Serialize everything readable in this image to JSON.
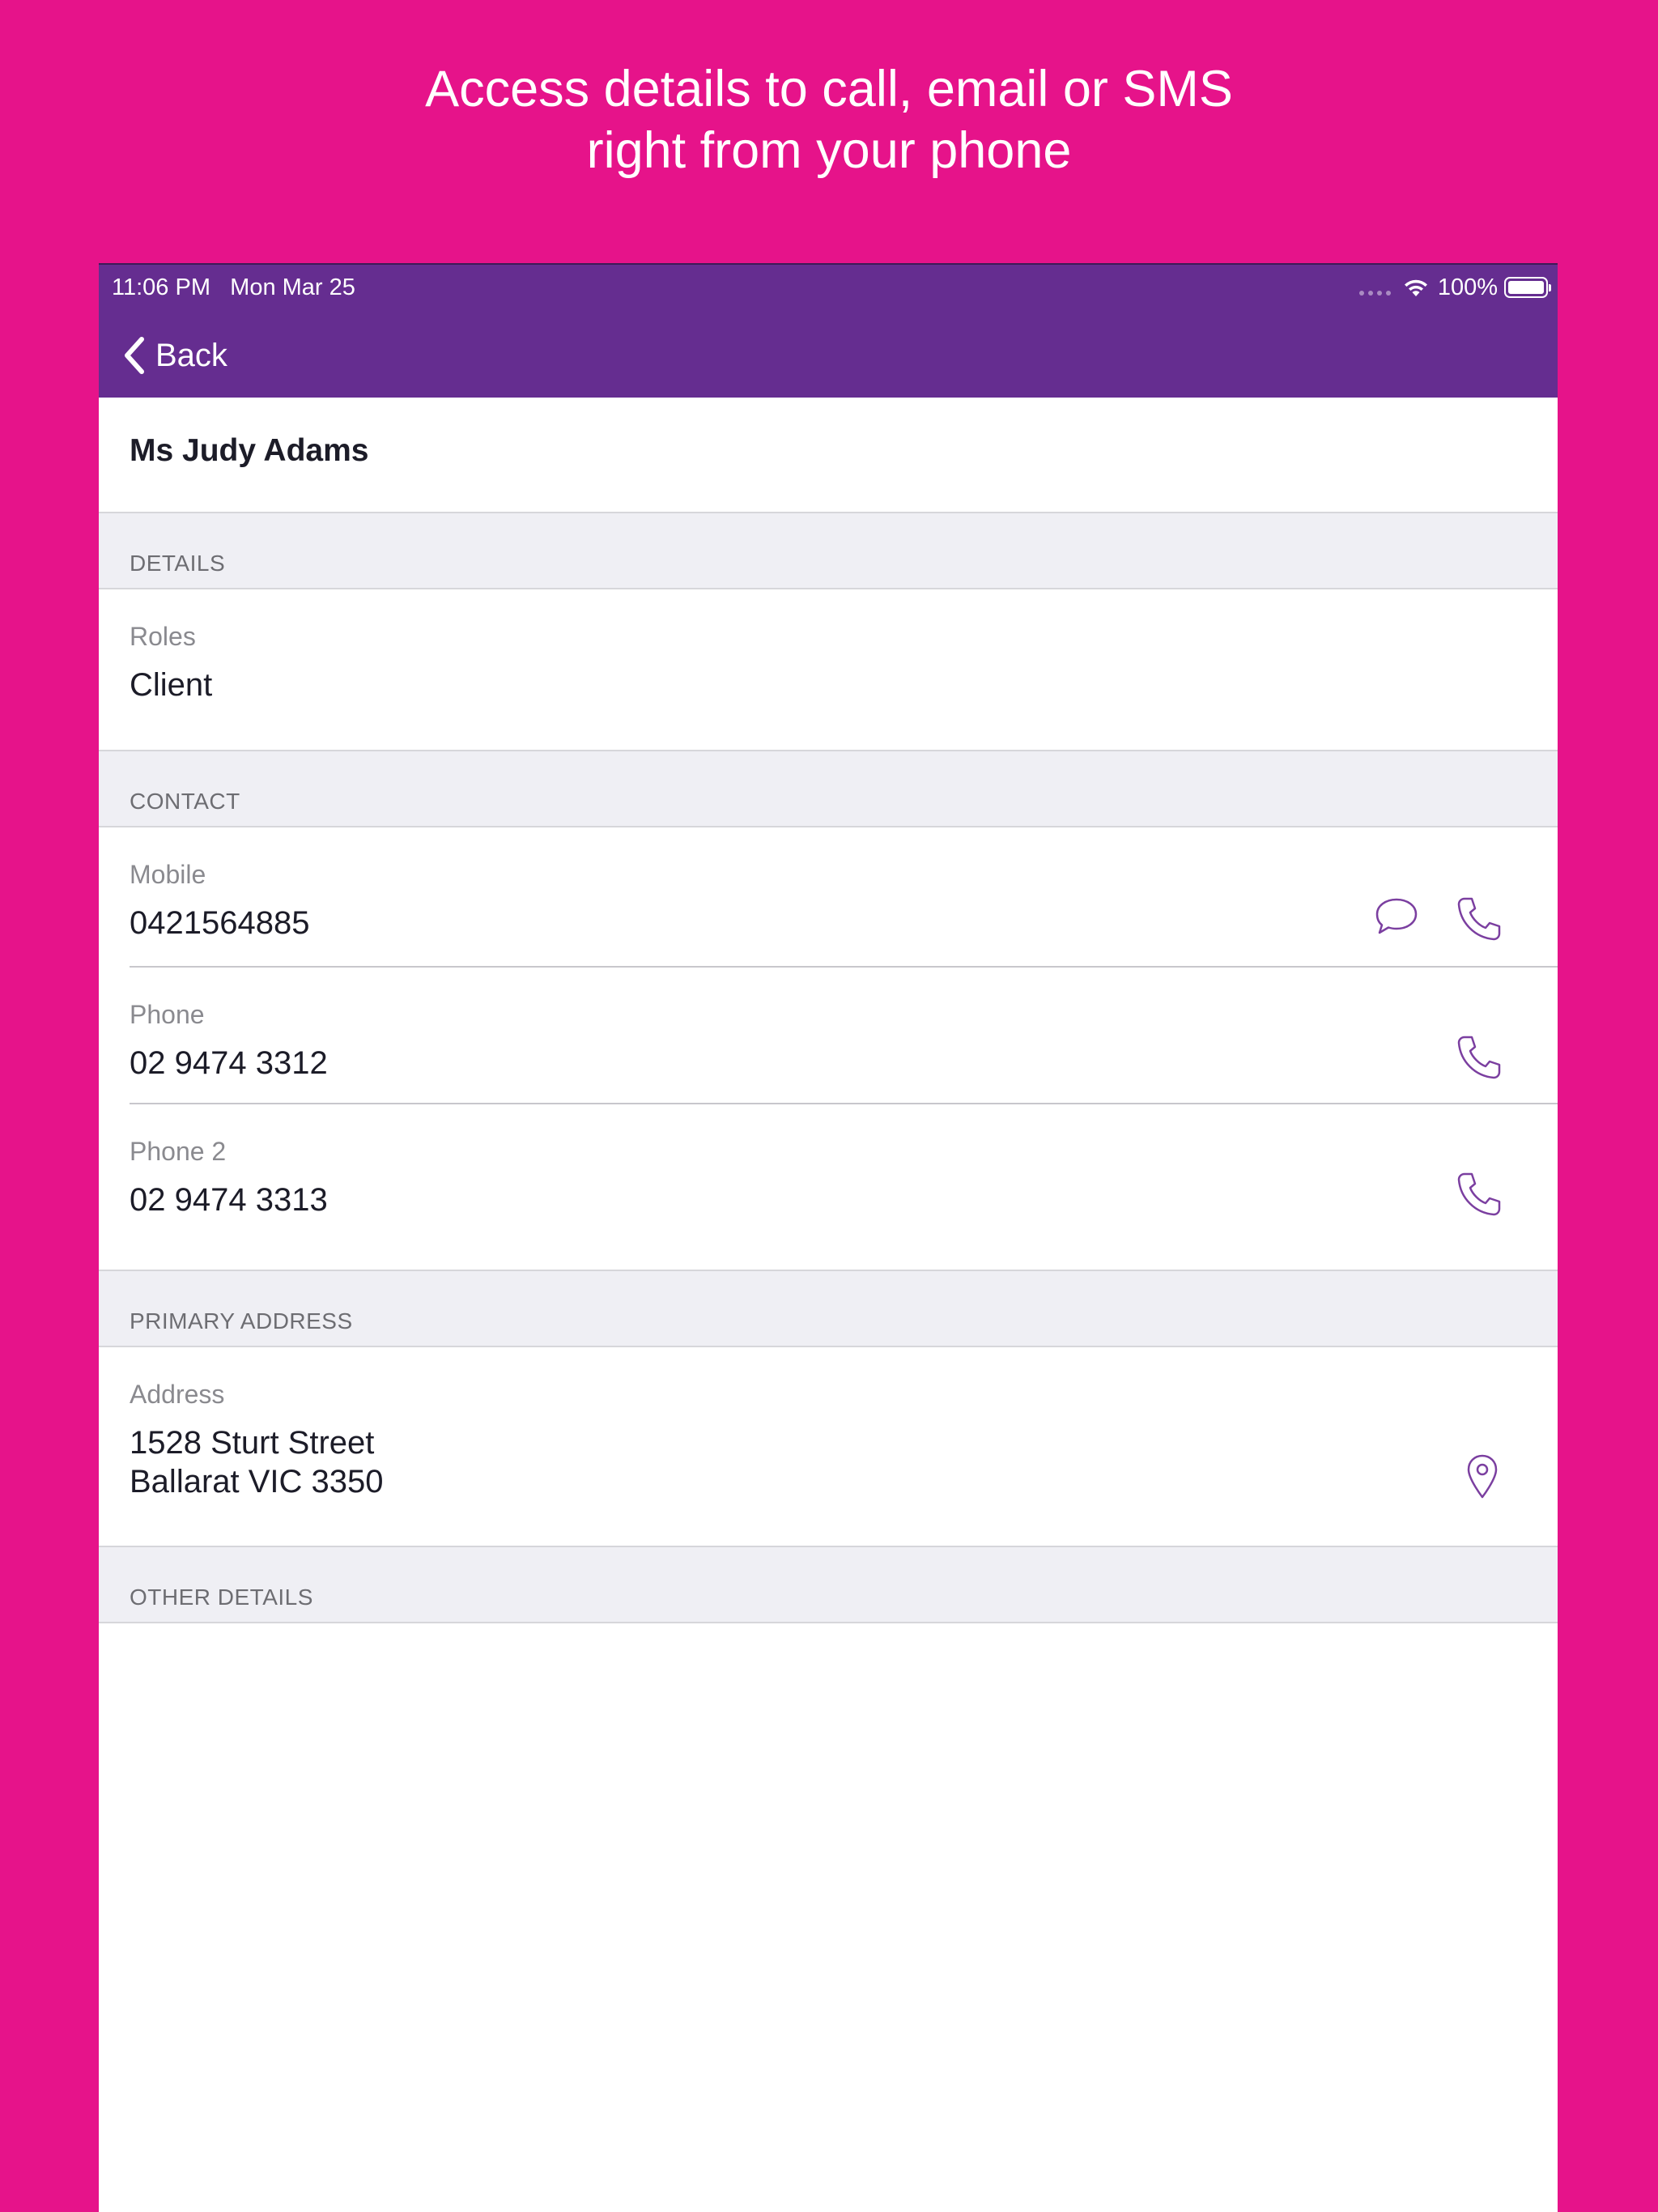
{
  "promo": {
    "line1": "Access details to call, email or SMS",
    "line2": "right from your phone"
  },
  "status_bar": {
    "time": "11:06 PM",
    "date": "Mon Mar 25",
    "battery": "100%"
  },
  "nav": {
    "back_label": "Back"
  },
  "contact": {
    "name": "Ms Judy Adams"
  },
  "sections": {
    "details": "DETAILS",
    "contact": "CONTACT",
    "primary_address": "PRIMARY ADDRESS",
    "other_details": "OTHER DETAILS"
  },
  "fields": {
    "roles": {
      "label": "Roles",
      "value": "Client"
    },
    "mobile": {
      "label": "Mobile",
      "value": "0421564885"
    },
    "phone": {
      "label": "Phone",
      "value": "02 9474 3312"
    },
    "phone2": {
      "label": "Phone 2",
      "value": "02 9474 3313"
    },
    "address": {
      "label": "Address",
      "line1": "1528 Sturt Street",
      "line2": "Ballarat VIC 3350"
    }
  },
  "icons": {
    "sms": "speech-bubble-icon",
    "call": "phone-icon",
    "map": "map-pin-icon",
    "back": "chevron-left-icon"
  },
  "colors": {
    "background": "#e6138a",
    "nav_bar": "#652d90",
    "icon_accent": "#7b3fa0",
    "section_bg": "#efeff4"
  }
}
